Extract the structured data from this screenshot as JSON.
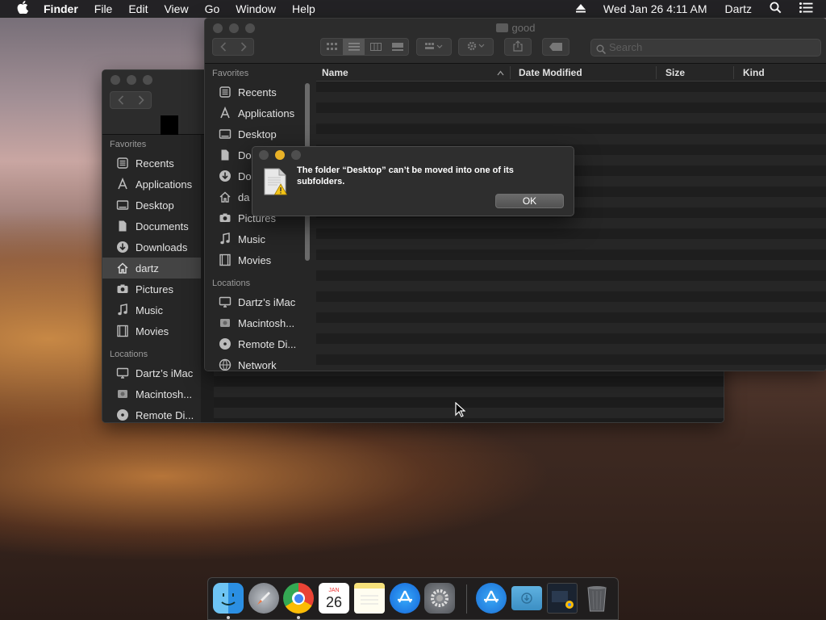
{
  "menubar": {
    "apple": "",
    "app": "Finder",
    "items": [
      "File",
      "Edit",
      "View",
      "Go",
      "Window",
      "Help"
    ],
    "clock": "Wed Jan 26  4:11 AM",
    "user": "Dartz"
  },
  "front_window": {
    "title": "good",
    "search_placeholder": "Search",
    "sidebar": {
      "favorites_header": "Favorites",
      "favorites": [
        "Recents",
        "Applications",
        "Desktop",
        "Do",
        "Do",
        "da",
        "Pictures",
        "Music",
        "Movies"
      ],
      "locations_header": "Locations",
      "locations": [
        "Dartz’s iMac",
        "Macintosh...",
        "Remote Di...",
        "Network"
      ]
    },
    "columns": {
      "name": "Name",
      "date": "Date Modified",
      "size": "Size",
      "kind": "Kind"
    }
  },
  "back_window": {
    "sidebar": {
      "favorites_header": "Favorites",
      "favorites": [
        "Recents",
        "Applications",
        "Desktop",
        "Documents",
        "Downloads",
        "dartz",
        "Pictures",
        "Music",
        "Movies"
      ],
      "selected": "dartz",
      "locations_header": "Locations",
      "locations": [
        "Dartz’s iMac",
        "Macintosh...",
        "Remote Di..."
      ]
    }
  },
  "alert": {
    "message": "The folder “Desktop” can’t be moved into one of its subfolders.",
    "ok_label": "OK"
  },
  "dock": {
    "calendar_month": "JAN",
    "calendar_day": "26",
    "apps": [
      "finder-icon",
      "launchpad-icon",
      "chrome-icon",
      "calendar-icon",
      "notes-icon",
      "app-store-icon",
      "system-preferences-icon",
      "applications-folder-icon",
      "downloads-folder-icon",
      "window-stack-icon",
      "trash-icon"
    ]
  }
}
